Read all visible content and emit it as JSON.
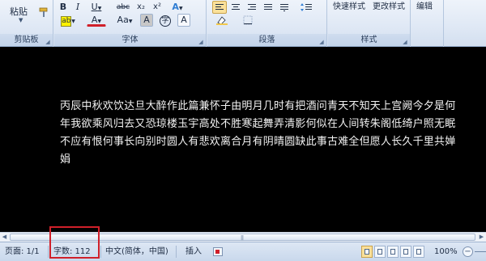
{
  "ribbon": {
    "clipboard": {
      "paste_label": "粘贴",
      "group_label": "剪贴板"
    },
    "font": {
      "group_label": "字体",
      "strike_label": "abc",
      "subscript_label": "x₂",
      "superscript_label": "x²",
      "bold_label": "B",
      "italic_label": "I",
      "underline_label": "U",
      "font_color_label": "A",
      "grow_label": "A",
      "char_border_label": "A",
      "enclose_label": "字",
      "change_case_label": "Aa",
      "text_effect_label": "A"
    },
    "paragraph": {
      "group_label": "段落"
    },
    "styles": {
      "quick_styles_label": "快速样式",
      "change_styles_label": "更改样式",
      "group_label": "样式"
    },
    "editing": {
      "label": "编辑"
    }
  },
  "document": {
    "lines": [
      "丙辰中秋欢饮达旦大醉作此篇兼怀子由明月几时有把酒问青天不知天上宫阙今夕是何",
      "年我欲乘风归去又恐琼楼玉宇高处不胜寒起舞弄清影何似在人间转朱阁低绮户照无眠",
      "不应有恨何事长向别时圆人有悲欢离合月有阴晴圆缺此事古难全但愿人长久千里共婵",
      "娟"
    ]
  },
  "statusbar": {
    "page": "页面: 1/1",
    "word_count": "字数: 112",
    "language": "中文(简体，中国)",
    "insert_mode": "插入",
    "zoom": "100%"
  },
  "colors": {
    "highlight_border": "#d0202a",
    "document_background": "#000000",
    "document_text": "#f2f2f2"
  }
}
